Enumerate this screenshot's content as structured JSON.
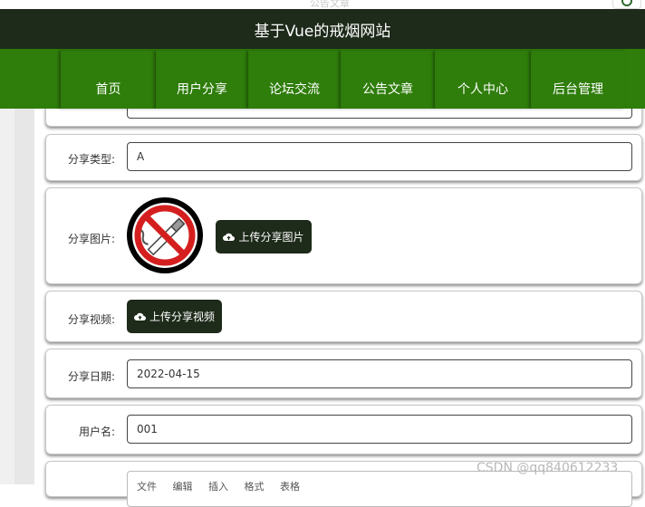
{
  "top": {
    "ghost_text": "公告文章"
  },
  "header": {
    "title": "基于Vue的戒烟网站"
  },
  "nav": {
    "items": [
      {
        "label": "首页"
      },
      {
        "label": "用户分享"
      },
      {
        "label": "论坛交流"
      },
      {
        "label": "公告文章"
      },
      {
        "label": "个人中心"
      },
      {
        "label": "后台管理"
      }
    ]
  },
  "form": {
    "share_type": {
      "label": "分享类型:",
      "value": "A"
    },
    "share_image": {
      "label": "分享图片:",
      "button": "上传分享图片",
      "image_icon": "no-smoking-icon"
    },
    "share_video": {
      "label": "分享视频:",
      "button": "上传分享视频"
    },
    "share_date": {
      "label": "分享日期:",
      "value": "2022-04-15"
    },
    "username": {
      "label": "用户名:",
      "value": "001"
    },
    "editor": {
      "menu": "文件 编辑 插入 格式 表格"
    }
  },
  "watermark": "CSDN @qq840612233",
  "colors": {
    "header_bg": "#1e2a1a",
    "nav_bg": "#2f7d0b",
    "button_bg": "#1e2a1a"
  }
}
